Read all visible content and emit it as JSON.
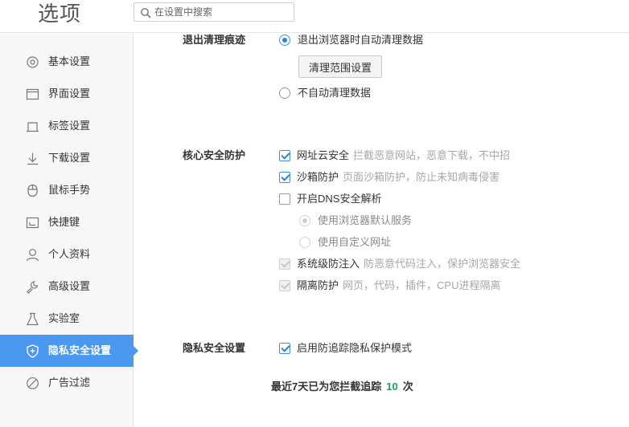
{
  "header": {
    "title": "选项",
    "search_placeholder": "在设置中搜索"
  },
  "sidebar": {
    "items": [
      {
        "label": "基本设置",
        "icon": "gear-icon"
      },
      {
        "label": "界面设置",
        "icon": "window-icon"
      },
      {
        "label": "标签设置",
        "icon": "tab-icon"
      },
      {
        "label": "下载设置",
        "icon": "download-icon"
      },
      {
        "label": "鼠标手势",
        "icon": "mouse-icon"
      },
      {
        "label": "快捷键",
        "icon": "shortcut-icon"
      },
      {
        "label": "个人资料",
        "icon": "user-icon"
      },
      {
        "label": "高级设置",
        "icon": "wrench-icon"
      },
      {
        "label": "实验室",
        "icon": "flask-icon"
      },
      {
        "label": "隐私安全设置",
        "icon": "shield-icon",
        "active": true
      },
      {
        "label": "广告过滤",
        "icon": "block-icon"
      }
    ]
  },
  "clear_traces": {
    "title": "退出清理痕迹",
    "option_auto_clear": "退出浏览器时自动清理数据",
    "range_button": "清理范围设置",
    "option_no_clear": "不自动清理数据"
  },
  "core_security": {
    "title": "核心安全防护",
    "url_cloud": {
      "label": "网址云安全",
      "desc": "拦截恶意网站，恶意下载，不中招"
    },
    "sandbox": {
      "label": "沙箱防护",
      "desc": "页面沙箱防护，防止未知病毒侵害"
    },
    "dns": {
      "label": "开启DNS安全解析"
    },
    "dns_default": "使用浏览器默认服务",
    "dns_custom": "使用自定义网址",
    "system_injection": {
      "label": "系统级防注入",
      "desc": "防恶意代码注入，保护浏览器安全"
    },
    "isolation": {
      "label": "隔离防护",
      "desc": "网页，代码，插件，CPU进程隔离"
    }
  },
  "privacy": {
    "title": "隐私安全设置",
    "anti_tracking": "启用防追踪隐私保护模式",
    "stat_prefix": "最近7天已为您拦截追踪",
    "stat_count": "10",
    "stat_suffix": "次"
  },
  "colors": {
    "accent": "#4a98f0",
    "count_green": "#1aa260"
  }
}
